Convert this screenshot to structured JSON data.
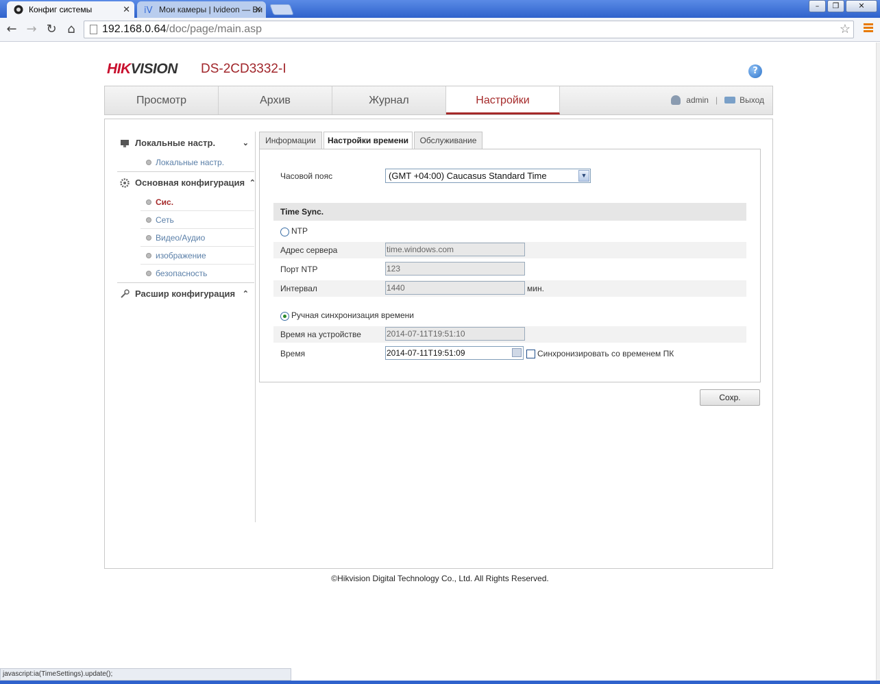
{
  "browser": {
    "tabs": [
      {
        "title": "Конфиг системы",
        "close": "✕"
      },
      {
        "title": "Мои камеры | Ivideon — Ви",
        "close": "✕"
      }
    ],
    "url_host": "192.168.0.64",
    "url_path": "/doc/page/main.asp",
    "status_text": "javascript:ia(TimeSettings).update();"
  },
  "header": {
    "logo_hik": "HIK",
    "logo_vision": "VISION",
    "model": "DS-2CD3332-I",
    "help": "?"
  },
  "main_nav": {
    "tabs": [
      "Просмотр",
      "Архив",
      "Журнал",
      "Настройки"
    ],
    "active": "Настройки",
    "user": "admin",
    "separator": "|",
    "logout": "Выход"
  },
  "sidebar": {
    "sections": [
      {
        "label": "Локальные настр.",
        "chevron": "⌄",
        "items": [
          "Локальные настр."
        ]
      },
      {
        "label": "Основная конфигурация",
        "chevron": "⌃",
        "items": [
          "Сис.",
          "Сеть",
          "Видео/Аудио",
          "изображение",
          "безопасность"
        ]
      },
      {
        "label": "Расшир конфигурация",
        "chevron": "⌃",
        "items": []
      }
    ],
    "active_item": "Сис."
  },
  "subtabs": [
    "Информации",
    "Настройки времени",
    "Обслуживание"
  ],
  "form": {
    "timezone_label": "Часовой пояс",
    "timezone_value": "(GMT +04:00) Caucasus Standard Time",
    "time_sync_header": "Time Sync.",
    "ntp_label": "NTP",
    "server_label": "Адрес сервера",
    "server_value": "time.windows.com",
    "port_label": "Порт NTP",
    "port_value": "123",
    "interval_label": "Интервал",
    "interval_value": "1440",
    "interval_unit": "мин.",
    "manual_label": "Ручная синхронизация времени",
    "device_time_label": "Время на устройстве",
    "device_time_value": "2014-07-11T19:51:10",
    "time_label": "Время",
    "time_value": "2014-07-11T19:51:09",
    "sync_pc_label": "Синхронизировать со временем ПК",
    "save_label": "Сохр."
  },
  "footer": "©Hikvision Digital Technology Co., Ltd. All Rights Reserved.",
  "colors": {
    "brand_red": "#c8102e",
    "active_tab": "#a52a2a",
    "link": "#5a7fa8"
  }
}
